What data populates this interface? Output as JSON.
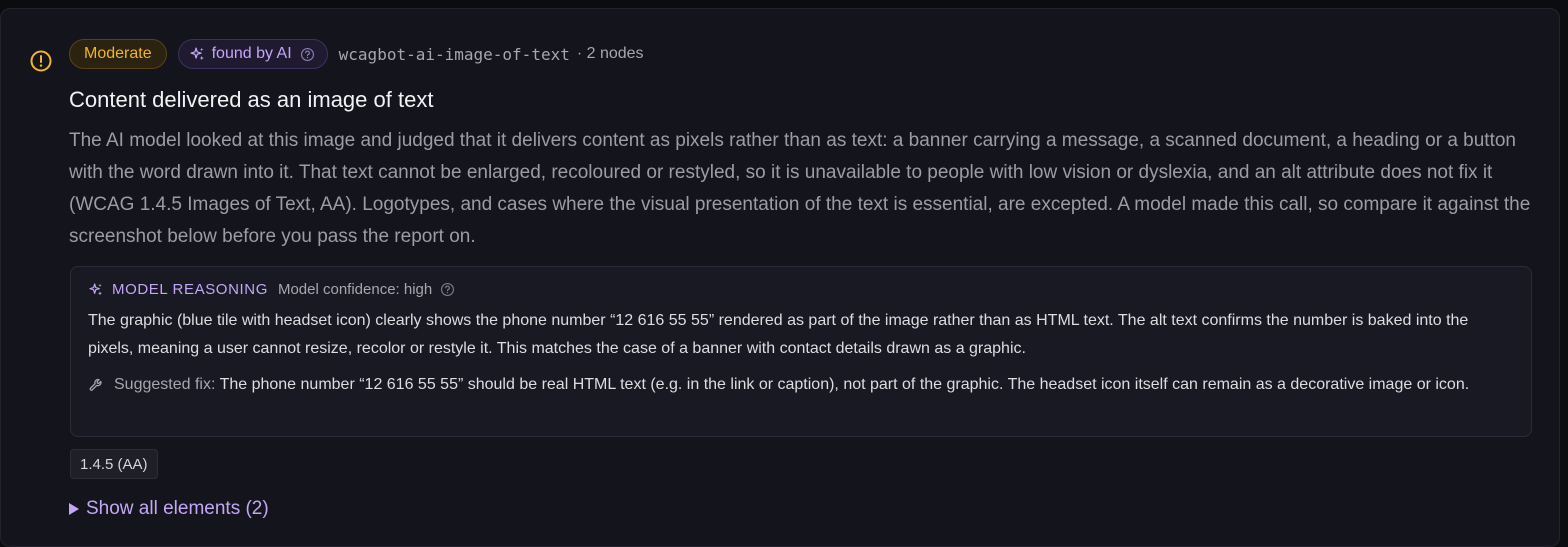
{
  "colors": {
    "moderate": "#f0b429",
    "ai_accent": "#c3a6f5",
    "card_bg": "#14151c",
    "text_muted": "#9c9da4"
  },
  "issue": {
    "severity_label": "Moderate",
    "severity_icon": "alert-circle-icon",
    "ai_badge_label": "found by AI",
    "ai_badge_icon": "sparkles-icon",
    "help_icon": "question-circle-icon",
    "rule_id": "wcagbot-ai-image-of-text",
    "node_count": "· 2 nodes",
    "title": "Content delivered as an image of text",
    "description": "The AI model looked at this image and judged that it delivers content as pixels rather than as text: a banner carrying a message, a scanned document, a heading or a button with the word drawn into it. That text cannot be enlarged, recoloured or restyled, so it is unavailable to people with low vision or dyslexia, and an alt attribute does not fix it (WCAG 1.4.5 Images of Text, AA). Logotypes, and cases where the visual presentation of the text is essential, are excepted. A model made this call, so compare it against the screenshot below before you pass the report on."
  },
  "reasoning": {
    "label": "MODEL REASONING",
    "confidence": "Model confidence: high",
    "text": "The graphic (blue tile with headset icon) clearly shows the phone number “12 616 55 55” rendered as part of the image rather than as HTML text. The alt text confirms the number is baked into the pixels, meaning a user cannot resize, recolor or restyle it. This matches the case of a banner with contact details drawn as a graphic.",
    "fix_label": "Suggested fix:",
    "fix_icon": "wrench-icon",
    "fix_text": "The phone number “12 616 55 55” should be real HTML text (e.g. in the link or caption), not part of the graphic. The headset icon itself can remain as a decorative image or icon."
  },
  "criterion_tag": "1.4.5 (AA)",
  "show_all": {
    "label": "Show all elements (2)",
    "icon": "triangle-right-icon"
  }
}
